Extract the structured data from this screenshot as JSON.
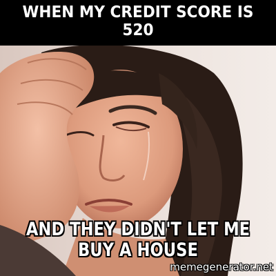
{
  "meme": {
    "top_text": "WHEN MY CREDIT SCORE IS 520",
    "bottom_text": "AND THEY DIDN'T LET ME BUY A HOUSE",
    "watermark": "memegenerator.net"
  },
  "colors": {
    "background": "#000000",
    "text": "#ffffff",
    "text_outline": "#000000",
    "skin": "#e6a88b",
    "hair": "#2a1c16",
    "wall": "#e9ddd6"
  }
}
